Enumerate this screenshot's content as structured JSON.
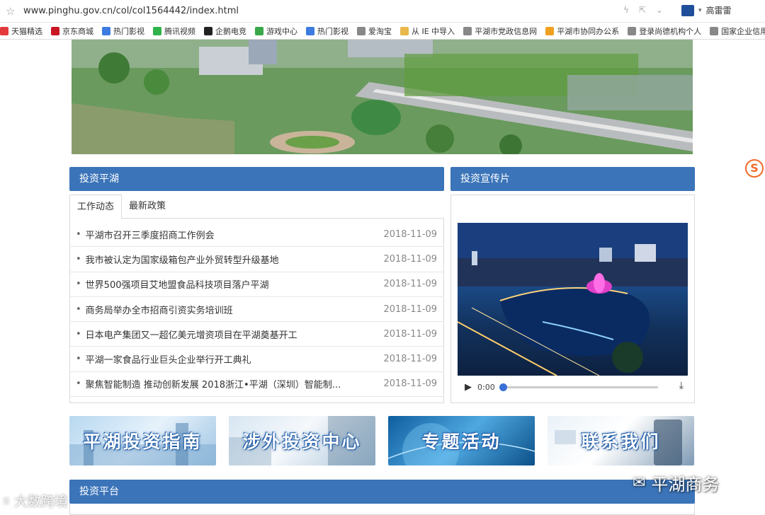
{
  "address_bar": {
    "url": "www.pinghu.gov.cn/col/col1564442/index.html",
    "user_name": "高雷雷"
  },
  "bookmarks": [
    {
      "label": "天猫精选",
      "icon": "tmall-icon",
      "color": "#e4393c"
    },
    {
      "label": "京东商城",
      "icon": "jd-icon",
      "color": "#c81623"
    },
    {
      "label": "热门影视",
      "icon": "paw-icon",
      "color": "#3d7be0"
    },
    {
      "label": "腾讯视频",
      "icon": "play-icon",
      "color": "#2fb34a"
    },
    {
      "label": "企鹅电竞",
      "icon": "penguin-icon",
      "color": "#222222"
    },
    {
      "label": "游戏中心",
      "icon": "gamepad-icon",
      "color": "#38a84a"
    },
    {
      "label": "热门影视",
      "icon": "paw-icon",
      "color": "#3d7be0"
    },
    {
      "label": "爱淘宝",
      "icon": "globe-icon",
      "color": "#888888"
    },
    {
      "label": "从 IE 中导入",
      "icon": "folder-icon",
      "color": "#e8b84a"
    },
    {
      "label": "平湖市党政信息网",
      "icon": "globe-icon",
      "color": "#888888"
    },
    {
      "label": "平湖市协同办公系",
      "icon": "orange-globe-icon",
      "color": "#f0a020"
    },
    {
      "label": "登录尚德机构个人",
      "icon": "globe-icon",
      "color": "#888888"
    },
    {
      "label": "国家企业信用",
      "icon": "globe-icon",
      "color": "#888888"
    }
  ],
  "invest_section": {
    "title": "投资平湖",
    "tabs": [
      "工作动态",
      "最新政策"
    ],
    "news": [
      {
        "title": "平湖市召开三季度招商工作例会",
        "date": "2018-11-09"
      },
      {
        "title": "我市被认定为国家级箱包产业外贸转型升级基地",
        "date": "2018-11-09"
      },
      {
        "title": "世界500强项目艾地盟食品科技项目落户平湖",
        "date": "2018-11-09"
      },
      {
        "title": "商务局举办全市招商引资实务培训班",
        "date": "2018-11-09"
      },
      {
        "title": "日本电产集团又一超亿美元增资项目在平湖奠基开工",
        "date": "2018-11-09"
      },
      {
        "title": "平湖一家食品行业巨头企业举行开工典礼",
        "date": "2018-11-09"
      },
      {
        "title": "聚焦智能制造 推动创新发展 2018浙江•平湖（深圳）智能制...",
        "date": "2018-11-09"
      }
    ]
  },
  "video_section": {
    "title": "投资宣传片",
    "time": "0:00",
    "progress": 0
  },
  "quick_links": [
    "平湖投资指南",
    "涉外投资中心",
    "专题活动",
    "联系我们"
  ],
  "platform_section": {
    "title": "投资平台"
  },
  "watermarks": {
    "left": "大数跨境",
    "right": "平湖商务"
  },
  "sogou_badge": "S"
}
